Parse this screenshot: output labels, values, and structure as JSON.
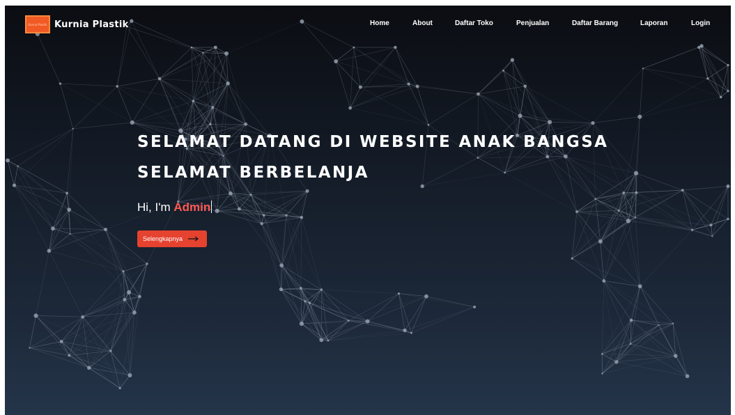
{
  "brand": {
    "logo_text": "Kurnia Plastik",
    "name": "Kurnia Plastik"
  },
  "nav": [
    {
      "label": "Home"
    },
    {
      "label": "About"
    },
    {
      "label": "Daftar Toko"
    },
    {
      "label": "Penjualan"
    },
    {
      "label": "Daftar Barang"
    },
    {
      "label": "Laporan"
    },
    {
      "label": "Login"
    }
  ],
  "hero": {
    "line1": "SELAMAT DATANG DI WEBSITE ANAK BANGSA",
    "line2": "SELAMAT BERBELANJA",
    "greeting_prefix": "Hi, I'm ",
    "greeting_name": "Admin",
    "cta_label": "Selengkapnya",
    "cta_icon": "arrow-right-icon"
  },
  "background": {
    "icon": "particle-network",
    "colors": {
      "top": "#0b0d12",
      "bottom": "#243449",
      "lines": "#8a96a6",
      "accent": "#e5422f",
      "highlight": "#ff5a52"
    }
  }
}
